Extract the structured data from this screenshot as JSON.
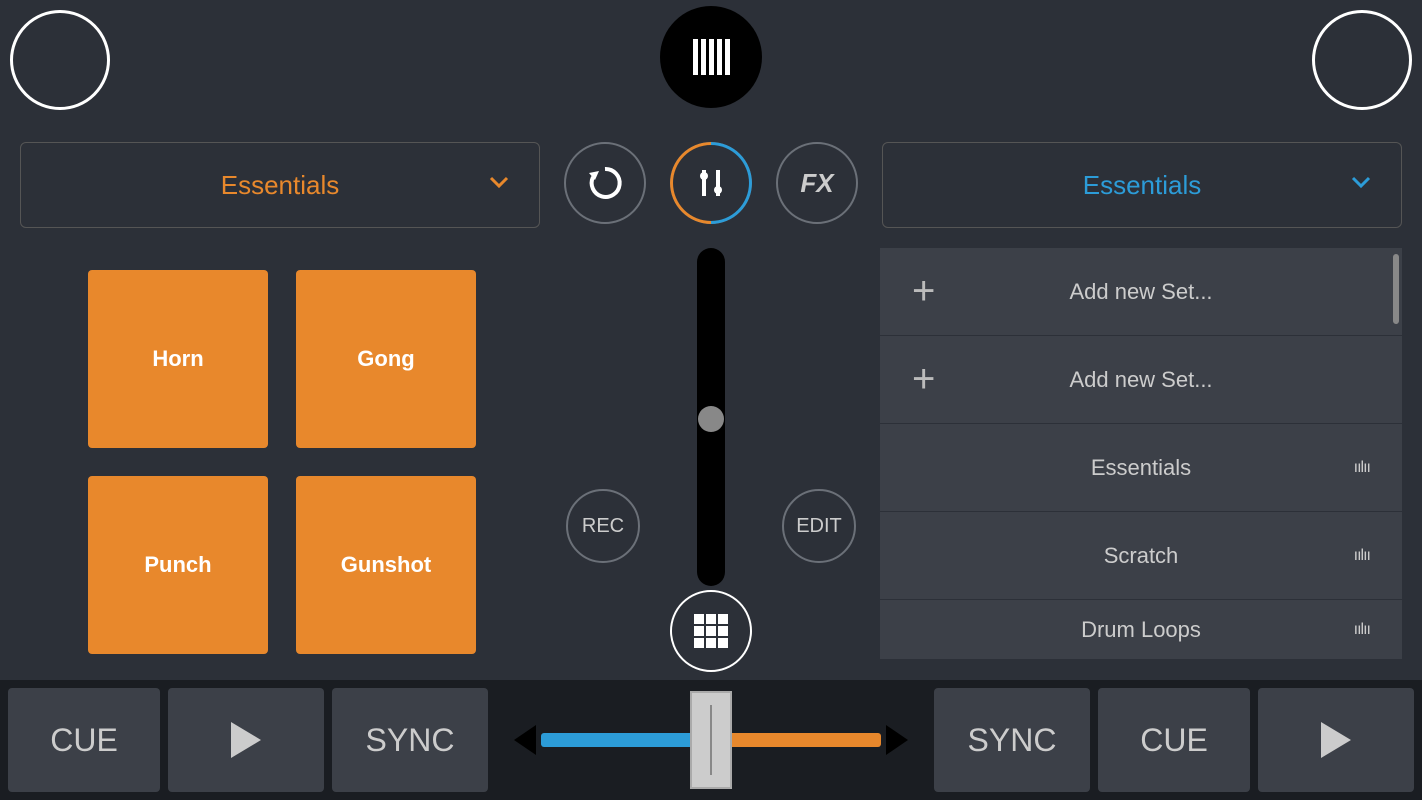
{
  "deck_left": {
    "dropdown_label": "Essentials",
    "pads": [
      "Horn",
      "Gong",
      "Punch",
      "Gunshot"
    ]
  },
  "deck_right": {
    "dropdown_label": "Essentials",
    "menu": [
      {
        "type": "add",
        "label": "Add new Set..."
      },
      {
        "type": "add",
        "label": "Add new Set..."
      },
      {
        "type": "set",
        "label": "Essentials"
      },
      {
        "type": "set",
        "label": "Scratch"
      },
      {
        "type": "set",
        "label": "Drum Loops"
      }
    ]
  },
  "center": {
    "fx_label": "FX",
    "rec_label": "REC",
    "edit_label": "EDIT"
  },
  "bottom": {
    "cue_label": "CUE",
    "sync_label": "SYNC"
  },
  "colors": {
    "deck_a": "#e8882c",
    "deck_b": "#2c9cd8"
  }
}
